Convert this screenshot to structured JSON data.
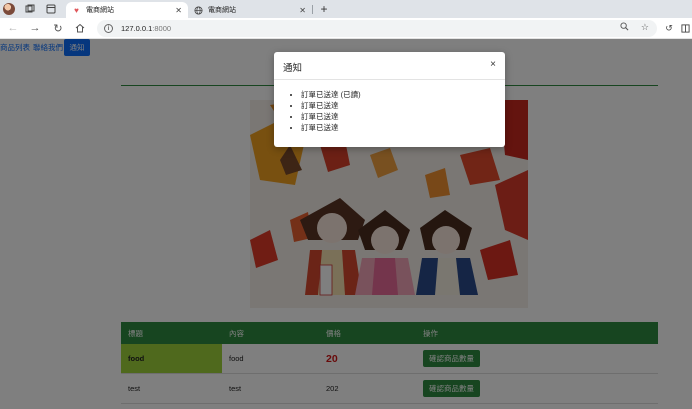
{
  "browser": {
    "tabs": [
      {
        "label": "電商網站",
        "active": true
      },
      {
        "label": "電商網站",
        "active": false
      }
    ],
    "url_host": "127.0.0.1",
    "url_port": ":8000"
  },
  "nav": {
    "items": [
      "商品列表",
      "聯絡我們"
    ],
    "notify_button": "通知"
  },
  "table": {
    "headers": [
      "標題",
      "內容",
      "價格",
      "操作"
    ],
    "rows": [
      {
        "title": "food",
        "content": "food",
        "price": "20",
        "action": "確認商品數量"
      },
      {
        "title": "test",
        "content": "test",
        "price": "202",
        "action": "確認商品數量"
      }
    ]
  },
  "modal": {
    "title": "通知",
    "close": "×",
    "items": [
      "訂單已送達 (已讀)",
      "訂單已送達",
      "訂單已送達",
      "訂單已送達"
    ]
  },
  "colors": {
    "primary": "#0d6efd",
    "success": "#2e8b40",
    "highlight": "#9fd33a",
    "price_red": "#d11414"
  }
}
